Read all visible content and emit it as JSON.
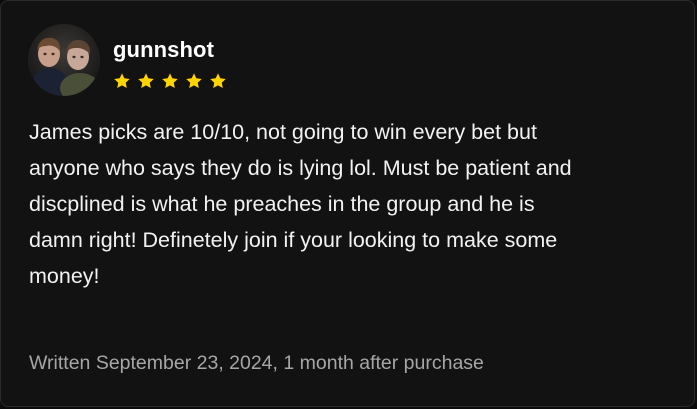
{
  "review": {
    "username": "gunnshot",
    "rating": 5,
    "rating_max": 5,
    "star_color": "#ffd400",
    "avatar_icon": "user-avatar-photo",
    "text": "James picks are 10/10, not going to win every bet but\nanyone who says they do is lying lol. Must be patient and\ndiscplined is what he preaches in the group and he is\ndamn right! Definetely join if your looking to make some\nmoney!",
    "footer": "Written September 23, 2024, 1 month after purchase"
  }
}
